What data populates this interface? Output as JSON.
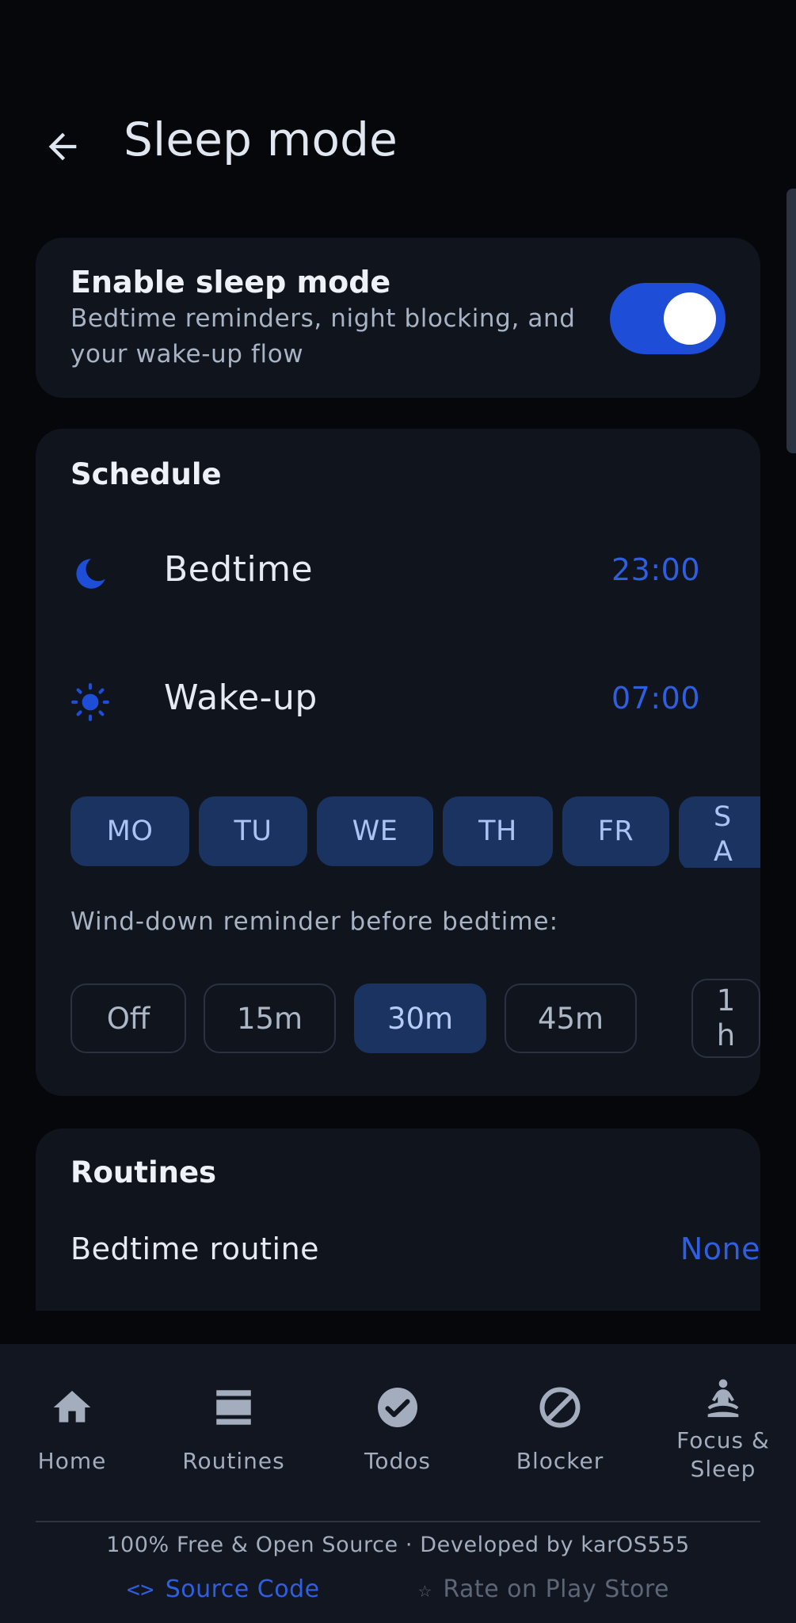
{
  "header": {
    "title": "Sleep mode"
  },
  "enable_card": {
    "title": "Enable sleep mode",
    "description": "Bedtime reminders, night blocking, and your wake-up flow",
    "enabled": true
  },
  "schedule": {
    "title": "Schedule",
    "bedtime": {
      "label": "Bedtime",
      "value": "23:00",
      "icon": "moon-icon"
    },
    "wakeup": {
      "label": "Wake-up",
      "value": "07:00",
      "icon": "sun-icon"
    },
    "days": [
      "MO",
      "TU",
      "WE",
      "TH",
      "FR"
    ],
    "days_partial": [
      "S",
      "A"
    ],
    "winddown_label": "Wind-down reminder before bedtime:",
    "winddown_options": [
      "Off",
      "15m",
      "30m",
      "45m"
    ],
    "winddown_partial": [
      "1",
      "h"
    ],
    "winddown_selected": "30m"
  },
  "routines": {
    "title": "Routines",
    "bedtime_routine": {
      "label": "Bedtime routine",
      "value": "None"
    }
  },
  "nav": {
    "items": [
      {
        "label": "Home",
        "icon": "home-icon"
      },
      {
        "label": "Routines",
        "icon": "routines-icon"
      },
      {
        "label": "Todos",
        "icon": "check-circle-icon"
      },
      {
        "label": "Blocker",
        "icon": "block-icon"
      },
      {
        "label_line1": "Focus &",
        "label_line2": "Sleep",
        "icon": "meditation-icon"
      }
    ]
  },
  "footer": {
    "text": "100% Free & Open Source · Developed by karOS555",
    "source_label": "Source Code",
    "rate_label": "Rate on Play Store"
  },
  "colors": {
    "accent": "#1e4ed8",
    "link": "#2f5fe0",
    "chip_selected": "#1a3360",
    "card": "#0f141d",
    "background": "#05070b"
  }
}
